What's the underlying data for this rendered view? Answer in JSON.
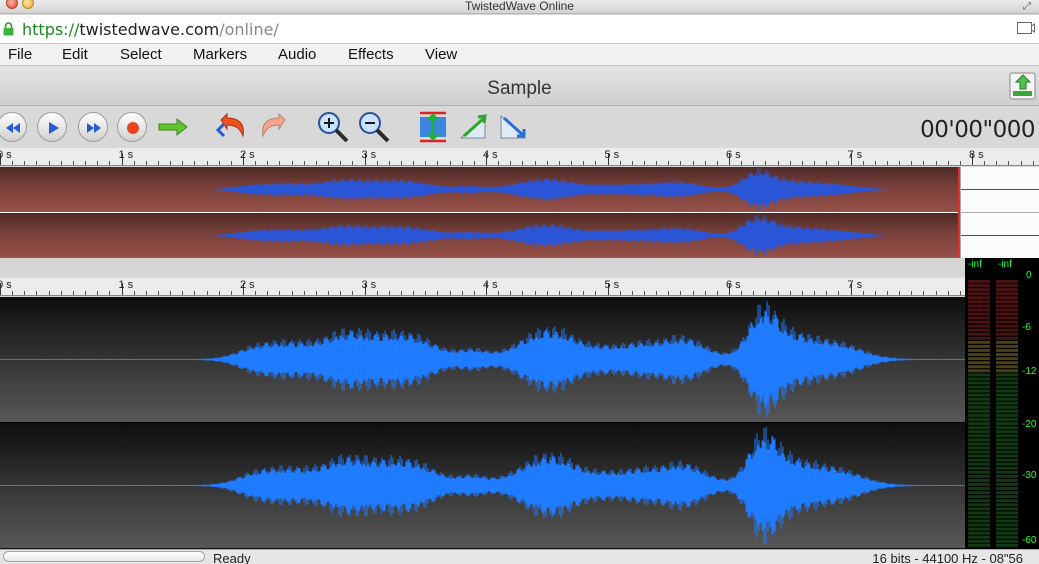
{
  "window": {
    "title": "TwistedWave Online"
  },
  "address": {
    "scheme": "https://",
    "host": "twistedwave.com",
    "path": "/online/"
  },
  "menu": {
    "items": [
      "File",
      "Edit",
      "Select",
      "Markers",
      "Audio",
      "Effects",
      "View"
    ]
  },
  "document": {
    "title": "Sample"
  },
  "toolbar": {
    "time": "00'00\"000",
    "buttons": [
      "rewind-icon",
      "play-icon",
      "fast-forward-icon",
      "record-icon",
      "go-right-icon",
      "undo-icon",
      "redo-icon",
      "zoom-in-icon",
      "zoom-out-icon",
      "fit-vertical-icon",
      "fade-in-icon",
      "fade-out-icon"
    ]
  },
  "top_ruler": {
    "labels": [
      "0 s",
      "1 s",
      "2 s",
      "3 s",
      "4 s",
      "5 s",
      "6 s",
      "7 s",
      "8 s"
    ]
  },
  "main_ruler": {
    "labels": [
      "0 s",
      "1 s",
      "2 s",
      "3 s",
      "4 s",
      "5 s",
      "6 s",
      "7 s"
    ]
  },
  "meters": {
    "left_label": "-inf",
    "right_label": "-inf",
    "db_labels": [
      "0",
      "-6",
      "-12",
      "-20",
      "-30",
      "-60"
    ]
  },
  "status": {
    "text": "Ready",
    "format": "16 bits - 44100 Hz - 08\"56"
  },
  "colors": {
    "waveform": "#1f7bff",
    "overview_background": "#7a403a",
    "meter_text": "#2dff2d",
    "cursor": "#e03131"
  }
}
